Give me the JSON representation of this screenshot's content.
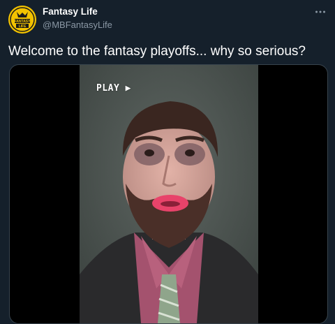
{
  "tweet": {
    "author_name": "Fantasy Life",
    "author_handle": "@MBFantasyLife",
    "text": "Welcome to the fantasy playoffs... why so serious?",
    "avatar_icon": "fantasy-life-logo",
    "avatar_logo_text": "FANTASY LIFE",
    "more_icon": "more-dots-icon"
  },
  "video": {
    "overlay_label": "PLAY ▶"
  },
  "colors": {
    "background": "#15202b",
    "secondary_text": "#8b98a5",
    "avatar_yellow": "#f2c200",
    "video_background": "#000000"
  }
}
